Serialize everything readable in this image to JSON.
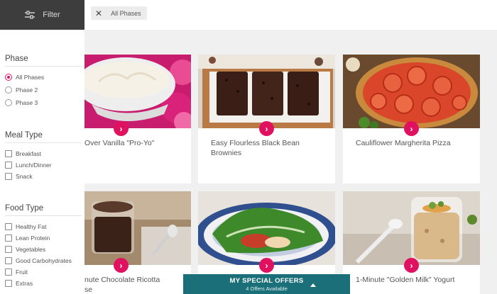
{
  "topbar": {
    "filter_label": "Filter",
    "active_chip": "All Phases"
  },
  "sidebar": {
    "phase": {
      "title": "Phase",
      "options": [
        "All Phases",
        "Phase 2",
        "Phase 3"
      ],
      "selected": "All Phases"
    },
    "meal_type": {
      "title": "Meal Type",
      "options": [
        "Breakfast",
        "Lunch/Dinner",
        "Snack"
      ]
    },
    "food_type": {
      "title": "Food Type",
      "options": [
        "Healthy Fat",
        "Lean Protein",
        "Vegetables",
        "Good Carbohydrates",
        "Fruit",
        "Extras"
      ]
    }
  },
  "recipes": [
    {
      "title_lines": [
        "Over Vanilla \"Pro-Yo\""
      ]
    },
    {
      "title_lines": [
        "Easy Flourless Black Bean",
        "Brownies"
      ]
    },
    {
      "title_lines": [
        "Cauliflower Margherita Pizza"
      ]
    },
    {
      "title_lines": [
        "nute Chocolate Ricotta",
        "se"
      ]
    },
    {
      "title_lines": [
        ""
      ]
    },
    {
      "title_lines": [
        "1-Minute \"Golden Milk\" Yogurt"
      ]
    }
  ],
  "offers": {
    "title": "MY SPECIAL OFFERS",
    "subtitle": "4 Offers Available"
  },
  "colors": {
    "accent": "#e0115f",
    "sidebar_header": "#3d3d3d",
    "offers_bar": "#1a6f78"
  },
  "icons": {
    "filter": "sliders-icon",
    "remove_chip": "close-icon",
    "card_action": "chevron-right-icon",
    "offers_toggle": "caret-up-icon"
  }
}
